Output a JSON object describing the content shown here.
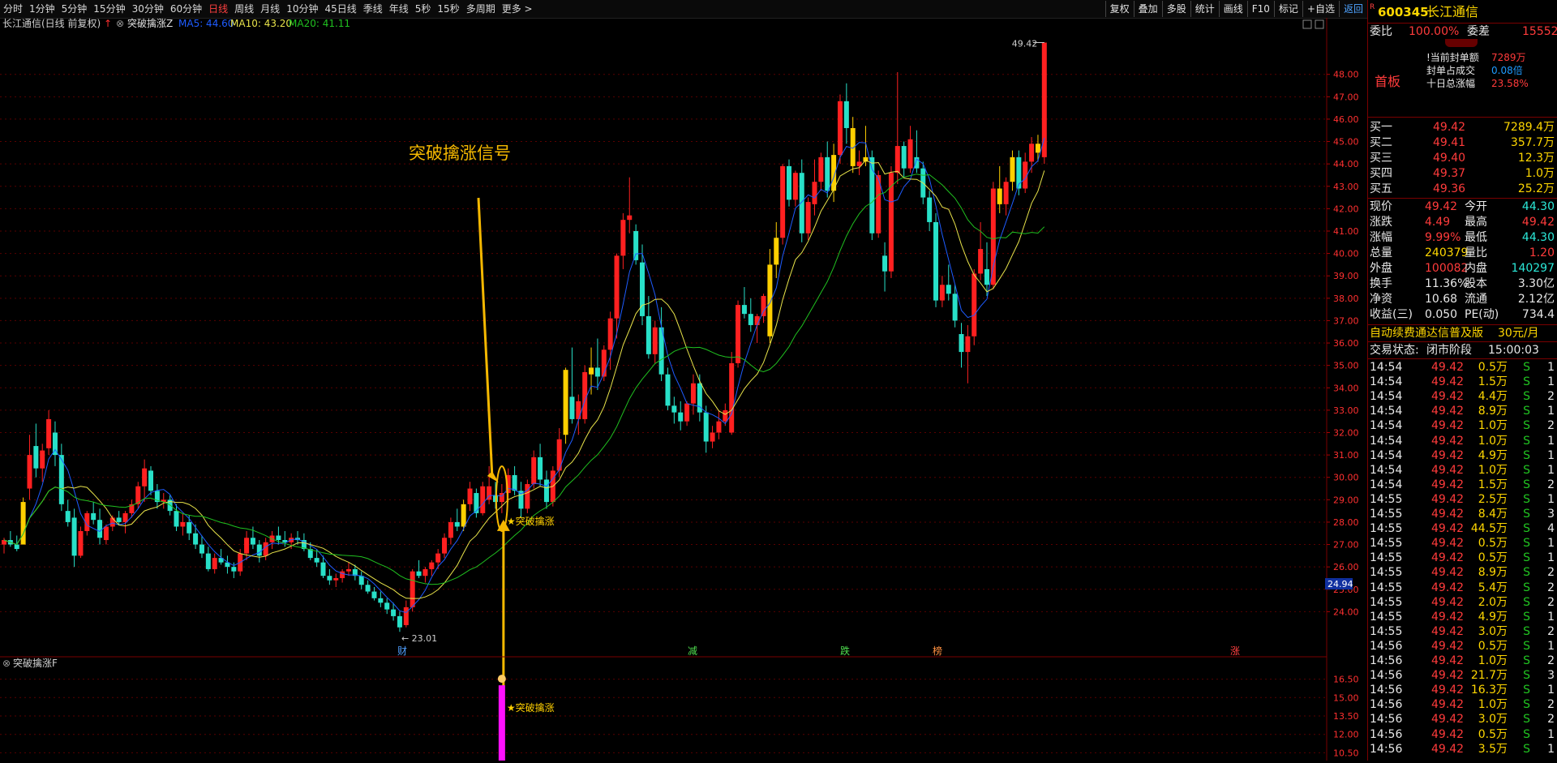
{
  "toolbar": {
    "periods": [
      "分时",
      "1分钟",
      "5分钟",
      "15分钟",
      "30分钟",
      "60分钟",
      "日线",
      "周线",
      "月线",
      "10分钟",
      "45日线",
      "季线",
      "年线",
      "5秒",
      "15秒",
      "多周期",
      "更多 >"
    ],
    "active_period": "日线",
    "right_buttons": [
      "复权",
      "叠加",
      "多股",
      "统计",
      "画线",
      "F10",
      "标记",
      "+自选",
      "返回"
    ]
  },
  "chart": {
    "header_title": "长江通信(日线 前复权)",
    "indicator_name": "突破擒涨Z",
    "ma5_label": "MA5: 44.60",
    "ma10_label": "MA10: 43.20",
    "ma20_label": "MA20: 41.11",
    "annotation_text": "突破擒涨信号",
    "signal_label": "★突破擒涨",
    "high_label": "49.42",
    "low_label": "← 23.01",
    "price_tag": "24.94",
    "event_markers": [
      "财",
      "减",
      "跌",
      "榜",
      "涨"
    ],
    "sub_indicator_name": "突破擒涨F",
    "sub_signal_label": "★突破擒涨",
    "colors": {
      "up": "#ff2020",
      "down": "#28e0c8",
      "signal": "#ffd000",
      "ma5": "#1e5cff",
      "ma10": "#e8e34a",
      "ma20": "#20c020",
      "magenta": "#ff10ff"
    }
  },
  "chart_data": {
    "type": "candlestick",
    "main_y_ticks": [
      "48.00",
      "47.00",
      "46.00",
      "45.00",
      "44.00",
      "43.00",
      "42.00",
      "41.00",
      "40.00",
      "39.00",
      "38.00",
      "37.00",
      "36.00",
      "35.00",
      "34.00",
      "33.00",
      "32.00",
      "31.00",
      "30.00",
      "29.00",
      "28.00",
      "27.00",
      "26.00",
      "25.00",
      "24.00"
    ],
    "ylim": [
      23.0,
      49.8
    ],
    "sub_y_ticks": [
      "16.50",
      "15.00",
      "13.50",
      "12.00",
      "10.50"
    ],
    "candles": [
      [
        27.0,
        27.3,
        26.6,
        27.2
      ],
      [
        27.2,
        27.6,
        26.9,
        27.0
      ],
      [
        27.0,
        27.4,
        26.7,
        26.8
      ],
      [
        27.0,
        29.1,
        27.0,
        28.9
      ],
      [
        29.5,
        31.9,
        29.0,
        31.0
      ],
      [
        31.4,
        32.4,
        30.0,
        30.4
      ],
      [
        30.4,
        31.5,
        29.8,
        31.2
      ],
      [
        31.3,
        33.0,
        31.0,
        32.6
      ],
      [
        32.0,
        32.5,
        30.5,
        31.0
      ],
      [
        31.0,
        31.5,
        28.5,
        28.8
      ],
      [
        28.5,
        29.0,
        27.8,
        28.0
      ],
      [
        28.2,
        28.6,
        26.0,
        26.5
      ],
      [
        26.5,
        27.8,
        26.4,
        27.6
      ],
      [
        27.6,
        28.5,
        27.4,
        28.4
      ],
      [
        28.4,
        28.9,
        27.9,
        28.1
      ],
      [
        28.1,
        28.6,
        27.0,
        27.3
      ],
      [
        27.2,
        27.9,
        27.0,
        27.8
      ],
      [
        27.8,
        28.3,
        27.6,
        28.2
      ],
      [
        28.2,
        28.5,
        27.9,
        28.0
      ],
      [
        28.0,
        28.5,
        27.5,
        28.4
      ],
      [
        28.4,
        29.0,
        28.2,
        28.8
      ],
      [
        28.8,
        29.8,
        28.6,
        29.6
      ],
      [
        29.6,
        30.8,
        28.9,
        30.4
      ],
      [
        30.3,
        30.5,
        29.2,
        29.4
      ],
      [
        29.4,
        29.7,
        28.6,
        28.9
      ],
      [
        28.9,
        29.3,
        28.6,
        29.0
      ],
      [
        29.0,
        29.2,
        28.3,
        28.5
      ],
      [
        28.5,
        28.8,
        27.6,
        27.8
      ],
      [
        27.8,
        28.4,
        27.4,
        28.0
      ],
      [
        28.0,
        28.3,
        27.2,
        27.5
      ],
      [
        27.5,
        27.9,
        26.8,
        27.0
      ],
      [
        27.0,
        27.4,
        26.4,
        26.6
      ],
      [
        26.6,
        26.9,
        25.8,
        25.9
      ],
      [
        25.9,
        26.6,
        25.7,
        26.4
      ],
      [
        26.4,
        26.8,
        26.1,
        26.2
      ],
      [
        26.2,
        26.5,
        25.7,
        26.0
      ],
      [
        26.0,
        26.2,
        25.5,
        25.8
      ],
      [
        25.8,
        26.8,
        25.6,
        26.6
      ],
      [
        26.6,
        27.6,
        26.3,
        27.3
      ],
      [
        27.3,
        27.8,
        26.8,
        27.0
      ],
      [
        27.0,
        27.2,
        26.2,
        26.5
      ],
      [
        26.5,
        27.3,
        26.3,
        27.1
      ],
      [
        27.1,
        27.6,
        26.8,
        27.4
      ],
      [
        27.4,
        27.8,
        27.0,
        27.2
      ],
      [
        27.2,
        27.6,
        26.9,
        27.1
      ],
      [
        27.1,
        27.5,
        26.8,
        27.3
      ],
      [
        27.3,
        27.6,
        27.0,
        27.2
      ],
      [
        27.2,
        27.5,
        26.7,
        26.8
      ],
      [
        26.8,
        27.1,
        26.3,
        26.4
      ],
      [
        26.4,
        26.8,
        26.0,
        26.2
      ],
      [
        26.2,
        26.5,
        25.5,
        25.6
      ],
      [
        25.6,
        25.9,
        25.2,
        25.4
      ],
      [
        25.4,
        25.7,
        25.1,
        25.5
      ],
      [
        25.5,
        25.9,
        25.3,
        25.8
      ],
      [
        25.8,
        26.2,
        25.6,
        25.9
      ],
      [
        25.9,
        26.1,
        25.4,
        25.6
      ],
      [
        25.6,
        25.8,
        25.0,
        25.2
      ],
      [
        25.2,
        25.4,
        24.8,
        24.9
      ],
      [
        24.9,
        25.1,
        24.5,
        24.6
      ],
      [
        24.6,
        24.9,
        24.2,
        24.4
      ],
      [
        24.4,
        24.6,
        23.9,
        24.1
      ],
      [
        24.1,
        24.4,
        23.6,
        23.8
      ],
      [
        23.8,
        24.0,
        23.1,
        23.3
      ],
      [
        23.4,
        24.5,
        23.3,
        24.2
      ],
      [
        24.2,
        25.9,
        24.0,
        25.8
      ],
      [
        25.8,
        26.3,
        25.5,
        25.6
      ],
      [
        25.6,
        26.0,
        25.3,
        25.9
      ],
      [
        25.9,
        26.3,
        25.6,
        26.2
      ],
      [
        26.2,
        26.8,
        25.9,
        26.6
      ],
      [
        26.6,
        27.5,
        26.4,
        27.3
      ],
      [
        27.3,
        28.2,
        27.0,
        28.0
      ],
      [
        28.0,
        28.6,
        27.6,
        27.8
      ],
      [
        27.8,
        29.0,
        27.6,
        28.8
      ],
      [
        28.8,
        29.8,
        28.5,
        29.5
      ],
      [
        29.3,
        29.5,
        28.2,
        28.4
      ],
      [
        28.4,
        29.8,
        28.3,
        29.6
      ],
      [
        29.0,
        30.5,
        28.8,
        29.6
      ],
      [
        29.2,
        29.8,
        28.6,
        28.9
      ],
      [
        28.9,
        29.7,
        28.4,
        29.3
      ],
      [
        29.3,
        30.4,
        28.9,
        30.1
      ],
      [
        30.1,
        30.5,
        29.2,
        29.4
      ],
      [
        29.4,
        29.8,
        28.2,
        28.6
      ],
      [
        28.6,
        29.9,
        28.4,
        29.7
      ],
      [
        29.7,
        31.2,
        29.5,
        30.9
      ],
      [
        30.9,
        31.5,
        29.6,
        29.9
      ],
      [
        29.9,
        30.3,
        28.6,
        28.9
      ],
      [
        28.9,
        30.5,
        28.7,
        30.3
      ],
      [
        30.3,
        32.2,
        30.0,
        31.7
      ],
      [
        31.9,
        34.9,
        31.5,
        34.8
      ],
      [
        33.6,
        35.8,
        32.4,
        32.6
      ],
      [
        32.6,
        33.7,
        31.9,
        33.4
      ],
      [
        32.6,
        35.0,
        32.4,
        34.7
      ],
      [
        34.6,
        35.8,
        33.7,
        34.9
      ],
      [
        34.9,
        36.2,
        33.9,
        34.5
      ],
      [
        34.5,
        35.9,
        34.3,
        35.7
      ],
      [
        35.7,
        37.4,
        34.8,
        37.1
      ],
      [
        37.1,
        40.0,
        36.2,
        39.9
      ],
      [
        39.9,
        41.8,
        39.3,
        41.5
      ],
      [
        41.5,
        43.4,
        40.9,
        41.7
      ],
      [
        41.0,
        41.3,
        39.5,
        39.7
      ],
      [
        39.6,
        40.4,
        36.8,
        37.2
      ],
      [
        37.2,
        38.1,
        35.3,
        35.5
      ],
      [
        35.5,
        37.0,
        35.1,
        36.7
      ],
      [
        36.7,
        37.6,
        34.3,
        34.6
      ],
      [
        34.6,
        34.9,
        33.0,
        33.2
      ],
      [
        33.2,
        33.6,
        32.4,
        32.9
      ],
      [
        32.9,
        33.4,
        32.1,
        32.5
      ],
      [
        32.5,
        33.4,
        32.3,
        33.3
      ],
      [
        33.3,
        34.6,
        32.8,
        34.2
      ],
      [
        34.2,
        34.6,
        32.5,
        32.9
      ],
      [
        32.9,
        33.2,
        31.1,
        31.6
      ],
      [
        31.6,
        32.3,
        31.3,
        32.0
      ],
      [
        32.0,
        33.0,
        31.7,
        32.5
      ],
      [
        32.5,
        33.3,
        32.3,
        33.0
      ],
      [
        32.0,
        35.6,
        31.9,
        35.1
      ],
      [
        35.1,
        37.9,
        34.9,
        37.7
      ],
      [
        37.7,
        38.5,
        37.1,
        37.3
      ],
      [
        37.3,
        38.0,
        36.5,
        36.8
      ],
      [
        36.8,
        37.3,
        36.0,
        37.2
      ],
      [
        37.2,
        38.2,
        36.9,
        38.1
      ],
      [
        36.3,
        40.2,
        36.0,
        39.5
      ],
      [
        39.5,
        41.4,
        38.9,
        40.7
      ],
      [
        40.7,
        44.0,
        40.4,
        43.9
      ],
      [
        43.9,
        44.2,
        42.1,
        42.4
      ],
      [
        42.4,
        43.7,
        42.1,
        43.6
      ],
      [
        43.6,
        44.2,
        40.5,
        40.9
      ],
      [
        40.9,
        42.5,
        40.6,
        42.3
      ],
      [
        42.2,
        44.2,
        41.7,
        43.2
      ],
      [
        43.2,
        44.5,
        42.8,
        44.3
      ],
      [
        44.3,
        45.0,
        42.5,
        42.8
      ],
      [
        42.8,
        44.9,
        42.3,
        44.4
      ],
      [
        44.4,
        47.1,
        44.0,
        46.8
      ],
      [
        46.8,
        47.6,
        44.9,
        45.6
      ],
      [
        45.6,
        46.1,
        43.6,
        43.9
      ],
      [
        43.9,
        44.6,
        43.5,
        44.1
      ],
      [
        44.1,
        45.7,
        43.9,
        44.3
      ],
      [
        44.3,
        44.6,
        40.6,
        40.9
      ],
      [
        40.9,
        43.7,
        40.7,
        43.5
      ],
      [
        39.9,
        40.5,
        38.3,
        39.2
      ],
      [
        39.2,
        43.9,
        38.9,
        43.6
      ],
      [
        43.6,
        48.1,
        43.1,
        44.8
      ],
      [
        44.8,
        45.0,
        43.4,
        43.8
      ],
      [
        43.8,
        45.7,
        43.6,
        45.1
      ],
      [
        44.3,
        45.5,
        43.6,
        43.8
      ],
      [
        43.8,
        44.1,
        42.2,
        42.5
      ],
      [
        42.5,
        42.8,
        41.0,
        41.4
      ],
      [
        41.4,
        41.8,
        37.6,
        37.9
      ],
      [
        37.9,
        39.0,
        37.6,
        38.6
      ],
      [
        38.6,
        39.5,
        37.9,
        38.2
      ],
      [
        38.2,
        38.6,
        36.7,
        37.0
      ],
      [
        36.4,
        36.9,
        34.9,
        35.6
      ],
      [
        35.6,
        36.8,
        34.2,
        36.3
      ],
      [
        36.3,
        39.3,
        35.9,
        39.1
      ],
      [
        39.1,
        41.4,
        38.8,
        40.2
      ],
      [
        39.3,
        40.5,
        38.1,
        38.6
      ],
      [
        38.6,
        43.2,
        38.4,
        42.9
      ],
      [
        42.9,
        43.9,
        41.8,
        42.2
      ],
      [
        42.2,
        43.4,
        41.7,
        43.2
      ],
      [
        43.2,
        44.6,
        42.8,
        44.3
      ],
      [
        44.3,
        44.6,
        42.6,
        42.9
      ],
      [
        42.9,
        44.5,
        42.7,
        44.1
      ],
      [
        44.1,
        45.2,
        43.6,
        44.9
      ],
      [
        44.9,
        45.3,
        44.1,
        44.5
      ],
      [
        44.3,
        49.42,
        44.0,
        49.42
      ]
    ],
    "signal_candles": [
      3,
      72,
      88,
      92,
      120,
      121,
      130,
      133,
      135,
      156,
      158,
      162,
      165,
      171,
      172,
      178,
      183,
      186
    ],
    "signal_index": 78,
    "sub_signal_value": 16.0
  },
  "panel": {
    "stock_code": "600345",
    "stock_name": "长江通信",
    "r_badge": "R",
    "weibi_label": "委比",
    "weibi_value": "100.00%",
    "weicha_label": "委差",
    "weicha_value": "15552",
    "board_label": "首板",
    "seal_lines": [
      {
        "label": "!当前封单额",
        "value": "7289万"
      },
      {
        "label": "封单占成交",
        "value": "0.08倍"
      },
      {
        "label": "十日总涨幅",
        "value": "23.58%"
      }
    ],
    "bids": [
      {
        "label": "买一",
        "price": "49.42",
        "vol": "7289.4万"
      },
      {
        "label": "买二",
        "price": "49.41",
        "vol": "357.7万"
      },
      {
        "label": "买三",
        "price": "49.40",
        "vol": "12.3万"
      },
      {
        "label": "买四",
        "price": "49.37",
        "vol": "1.0万"
      },
      {
        "label": "买五",
        "price": "49.36",
        "vol": "25.2万"
      }
    ],
    "stats": [
      {
        "l1": "现价",
        "v1": "49.42",
        "l2": "今开",
        "v2": "44.30",
        "c1": "r",
        "c2": "g"
      },
      {
        "l1": "涨跌",
        "v1": "4.49",
        "l2": "最高",
        "v2": "49.42",
        "c1": "r",
        "c2": "r"
      },
      {
        "l1": "涨幅",
        "v1": "9.99%",
        "l2": "最低",
        "v2": "44.30",
        "c1": "r",
        "c2": "g"
      },
      {
        "l1": "总量",
        "v1": "240379",
        "l2": "量比",
        "v2": "1.20",
        "c1": "y",
        "c2": "r"
      },
      {
        "l1": "外盘",
        "v1": "100082",
        "l2": "内盘",
        "v2": "140297",
        "c1": "r",
        "c2": "g"
      },
      {
        "l1": "换手",
        "v1": "11.36%",
        "l2": "股本",
        "v2": "3.30亿",
        "c1": "w",
        "c2": "w"
      },
      {
        "l1": "净资",
        "v1": "10.68",
        "l2": "流通",
        "v2": "2.12亿",
        "c1": "w",
        "c2": "w"
      },
      {
        "l1": "收益(三)",
        "v1": "0.050",
        "l2": "PE(动)",
        "v2": "734.4",
        "c1": "w",
        "c2": "w"
      }
    ],
    "promo_text": "自动续费通达信普及版",
    "promo_price": "30元/月",
    "trade_status_label": "交易状态:",
    "trade_status": "闭市阶段",
    "trade_time": "15:00:03",
    "ticks": [
      [
        "14:54",
        "49.42",
        "0.5万",
        "S",
        "1"
      ],
      [
        "14:54",
        "49.42",
        "1.5万",
        "S",
        "1"
      ],
      [
        "14:54",
        "49.42",
        "4.4万",
        "S",
        "2"
      ],
      [
        "14:54",
        "49.42",
        "8.9万",
        "S",
        "1"
      ],
      [
        "14:54",
        "49.42",
        "1.0万",
        "S",
        "2"
      ],
      [
        "14:54",
        "49.42",
        "1.0万",
        "S",
        "1"
      ],
      [
        "14:54",
        "49.42",
        "4.9万",
        "S",
        "1"
      ],
      [
        "14:54",
        "49.42",
        "1.0万",
        "S",
        "1"
      ],
      [
        "14:54",
        "49.42",
        "1.5万",
        "S",
        "2"
      ],
      [
        "14:55",
        "49.42",
        "2.5万",
        "S",
        "1"
      ],
      [
        "14:55",
        "49.42",
        "8.4万",
        "S",
        "3"
      ],
      [
        "14:55",
        "49.42",
        "44.5万",
        "S",
        "4"
      ],
      [
        "14:55",
        "49.42",
        "0.5万",
        "S",
        "1"
      ],
      [
        "14:55",
        "49.42",
        "0.5万",
        "S",
        "1"
      ],
      [
        "14:55",
        "49.42",
        "8.9万",
        "S",
        "2"
      ],
      [
        "14:55",
        "49.42",
        "5.4万",
        "S",
        "2"
      ],
      [
        "14:55",
        "49.42",
        "2.0万",
        "S",
        "2"
      ],
      [
        "14:55",
        "49.42",
        "4.9万",
        "S",
        "1"
      ],
      [
        "14:55",
        "49.42",
        "3.0万",
        "S",
        "2"
      ],
      [
        "14:56",
        "49.42",
        "0.5万",
        "S",
        "1"
      ],
      [
        "14:56",
        "49.42",
        "1.0万",
        "S",
        "2"
      ],
      [
        "14:56",
        "49.42",
        "21.7万",
        "S",
        "3"
      ],
      [
        "14:56",
        "49.42",
        "16.3万",
        "S",
        "1"
      ],
      [
        "14:56",
        "49.42",
        "1.0万",
        "S",
        "2"
      ],
      [
        "14:56",
        "49.42",
        "3.0万",
        "S",
        "2"
      ],
      [
        "14:56",
        "49.42",
        "0.5万",
        "S",
        "1"
      ],
      [
        "14:56",
        "49.42",
        "3.5万",
        "S",
        "1"
      ]
    ]
  }
}
